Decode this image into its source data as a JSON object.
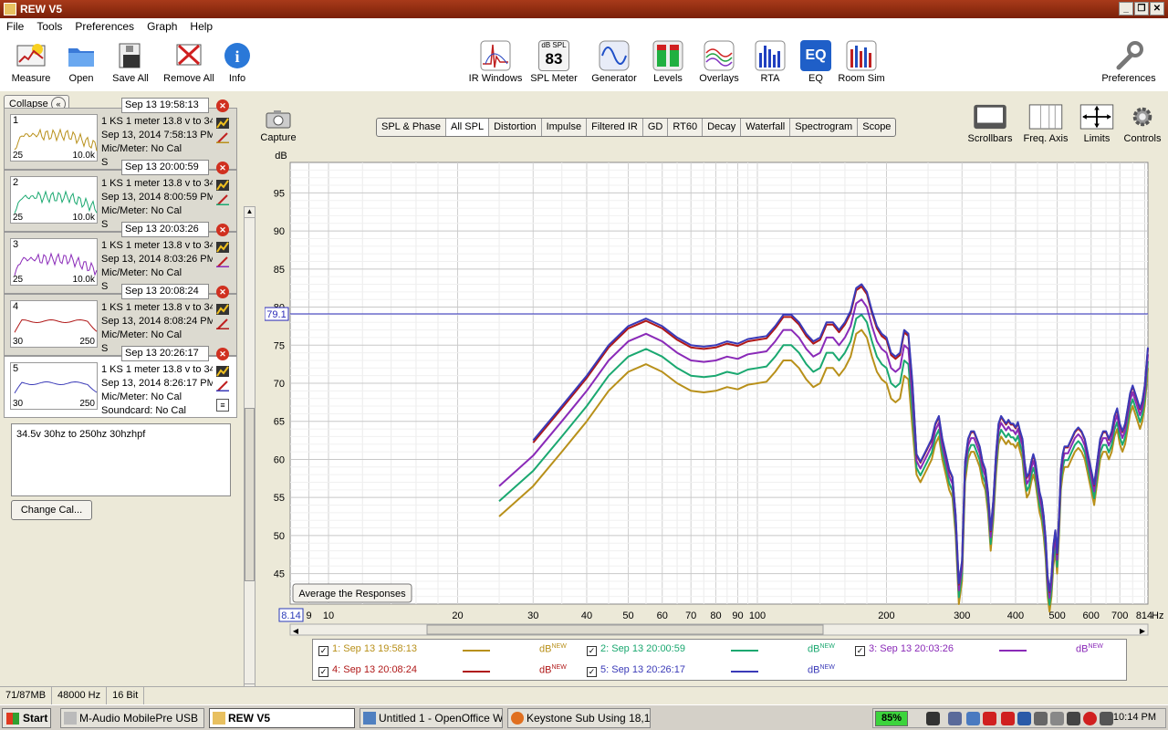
{
  "window": {
    "title": "REW V5"
  },
  "menu": [
    "File",
    "Tools",
    "Preferences",
    "Graph",
    "Help"
  ],
  "toolbar": {
    "left": [
      {
        "label": "Measure",
        "icon": "measure-icon"
      },
      {
        "label": "Open",
        "icon": "folder-icon"
      },
      {
        "label": "Save All",
        "icon": "save-icon"
      },
      {
        "label": "Remove All",
        "icon": "remove-icon"
      },
      {
        "label": "Info",
        "icon": "info-icon"
      }
    ],
    "center": [
      {
        "label": "IR Windows",
        "icon": "ir-windows-icon"
      },
      {
        "label": "SPL Meter",
        "icon": "spl-meter-icon",
        "badge_top": "dB SPL",
        "badge_value": "83"
      },
      {
        "label": "Generator",
        "icon": "generator-icon"
      },
      {
        "label": "Levels",
        "icon": "levels-icon"
      },
      {
        "label": "Overlays",
        "icon": "overlays-icon"
      },
      {
        "label": "RTA",
        "icon": "rta-icon"
      },
      {
        "label": "EQ",
        "icon": "eq-icon",
        "badge_value": "EQ"
      },
      {
        "label": "Room Sim",
        "icon": "room-sim-icon"
      }
    ],
    "right": {
      "label": "Preferences",
      "icon": "wrench-icon"
    }
  },
  "left_panel": {
    "collapse_label": "Collapse",
    "measurements": [
      {
        "num": "1",
        "date": "Sep 13 19:58:13",
        "line1": "1 KS 1 meter 13.8 v to 34",
        "line2": "Sep 13, 2014 7:58:13 PM",
        "line3": "Mic/Meter: No Cal",
        "line4": "S",
        "thumb_low": "25",
        "thumb_high": "10.0k",
        "color": "#b8901a"
      },
      {
        "num": "2",
        "date": "Sep 13 20:00:59",
        "line1": "1 KS 1 meter 13.8 v to 34",
        "line2": "Sep 13, 2014 8:00:59 PM",
        "line3": "Mic/Meter: No Cal",
        "line4": "S",
        "thumb_low": "25",
        "thumb_high": "10.0k",
        "color": "#1aa870"
      },
      {
        "num": "3",
        "date": "Sep 13 20:03:26",
        "line1": "1 KS 1 meter 13.8 v to 34",
        "line2": "Sep 13, 2014 8:03:26 PM",
        "line3": "Mic/Meter: No Cal",
        "line4": "S",
        "thumb_low": "25",
        "thumb_high": "10.0k",
        "color": "#8a2ab8"
      },
      {
        "num": "4",
        "date": "Sep 13 20:08:24",
        "line1": "1 KS 1 meter 13.8 v to 34",
        "line2": "Sep 13, 2014 8:08:24 PM",
        "line3": "Mic/Meter: No Cal",
        "line4": "S",
        "thumb_low": "30",
        "thumb_high": "250",
        "color": "#b01818"
      },
      {
        "num": "5",
        "date": "Sep 13 20:26:17",
        "line1": "1 KS 1 meter 13.8 v to 34",
        "line2": "Sep 13, 2014 8:26:17 PM",
        "line3": "Mic/Meter: No Cal",
        "line4": "Soundcard: No Cal",
        "thumb_low": "30",
        "thumb_high": "250",
        "color": "#3a3ab8"
      }
    ],
    "notes": "34.5v 30hz to 250hz 30hzhpf",
    "change_cal_label": "Change Cal..."
  },
  "capture_label": "Capture",
  "tabs": [
    "SPL & Phase",
    "All SPL",
    "Distortion",
    "Impulse",
    "Filtered IR",
    "GD",
    "RT60",
    "Decay",
    "Waterfall",
    "Spectrogram",
    "Scope"
  ],
  "active_tab": "All SPL",
  "right_tools": [
    {
      "label": "Scrollbars",
      "icon": "scrollbars-icon"
    },
    {
      "label": "Freq. Axis",
      "icon": "freq-axis-icon"
    },
    {
      "label": "Limits",
      "icon": "limits-icon"
    },
    {
      "label": "Controls",
      "icon": "gear-icon"
    }
  ],
  "average_button": "Average the Responses",
  "chart_data": {
    "type": "line",
    "ylabel": "dB",
    "xunit": "Hz",
    "xscale": "log",
    "xlim": [
      8.14,
      814
    ],
    "ylim": [
      41,
      99
    ],
    "yticks": [
      45,
      50,
      55,
      60,
      65,
      70,
      75,
      80,
      85,
      90,
      95
    ],
    "xtick_labels": [
      {
        "v": 8.14,
        "t": "8.14"
      },
      {
        "v": 9,
        "t": "9"
      },
      {
        "v": 10,
        "t": "10"
      },
      {
        "v": 20,
        "t": "20"
      },
      {
        "v": 30,
        "t": "30"
      },
      {
        "v": 40,
        "t": "40"
      },
      {
        "v": 50,
        "t": "50"
      },
      {
        "v": 60,
        "t": "60"
      },
      {
        "v": 70,
        "t": "70"
      },
      {
        "v": 80,
        "t": "80"
      },
      {
        "v": 90,
        "t": "90"
      },
      {
        "v": 100,
        "t": "100"
      },
      {
        "v": 200,
        "t": "200"
      },
      {
        "v": 300,
        "t": "300"
      },
      {
        "v": 400,
        "t": "400"
      },
      {
        "v": 500,
        "t": "500"
      },
      {
        "v": 600,
        "t": "600"
      },
      {
        "v": 700,
        "t": "700"
      },
      {
        "v": 814,
        "t": "814"
      }
    ],
    "cursor_y": 79.1,
    "cursor_label": "79.1",
    "series": [
      {
        "name": "1: Sep 13 19:58:13",
        "color": "#b8901a",
        "offset": 0,
        "start": 25
      },
      {
        "name": "2: Sep 13 20:00:59",
        "color": "#1aa870",
        "offset": 2.0,
        "start": 25
      },
      {
        "name": "3: Sep 13 20:03:26",
        "color": "#8a2ab8",
        "offset": 4.0,
        "start": 25
      },
      {
        "name": "4: Sep 13 20:08:24",
        "color": "#b01818",
        "offset": 5.7,
        "start": 30
      },
      {
        "name": "5: Sep 13 20:26:17",
        "color": "#3a3ab8",
        "offset": 6.0,
        "start": 30
      }
    ],
    "base_curve": [
      [
        25,
        52.5
      ],
      [
        30,
        56.5
      ],
      [
        35,
        61
      ],
      [
        40,
        65
      ],
      [
        45,
        69
      ],
      [
        50,
        71.5
      ],
      [
        55,
        72.5
      ],
      [
        60,
        71.5
      ],
      [
        65,
        70
      ],
      [
        70,
        69
      ],
      [
        75,
        68.8
      ],
      [
        80,
        69
      ],
      [
        85,
        69.5
      ],
      [
        90,
        69.2
      ],
      [
        95,
        69.8
      ],
      [
        100,
        70
      ],
      [
        105,
        70.2
      ],
      [
        110,
        71.5
      ],
      [
        115,
        73
      ],
      [
        120,
        73
      ],
      [
        125,
        72
      ],
      [
        130,
        70.5
      ],
      [
        135,
        69.5
      ],
      [
        140,
        70
      ],
      [
        145,
        72
      ],
      [
        150,
        72
      ],
      [
        155,
        71
      ],
      [
        160,
        72
      ],
      [
        165,
        73.5
      ],
      [
        170,
        76.5
      ],
      [
        175,
        77
      ],
      [
        180,
        76
      ],
      [
        185,
        73.5
      ],
      [
        190,
        71.5
      ],
      [
        195,
        70.5
      ],
      [
        200,
        70
      ],
      [
        205,
        68
      ],
      [
        210,
        67.5
      ],
      [
        215,
        68
      ],
      [
        220,
        71
      ],
      [
        225,
        70.5
      ],
      [
        230,
        64
      ],
      [
        235,
        58
      ],
      [
        240,
        57
      ],
      [
        245,
        58
      ],
      [
        250,
        59
      ],
      [
        255,
        60
      ],
      [
        260,
        62
      ],
      [
        265,
        63
      ],
      [
        270,
        60
      ],
      [
        275,
        58
      ],
      [
        280,
        56
      ],
      [
        285,
        55
      ],
      [
        290,
        50
      ],
      [
        295,
        41
      ],
      [
        300,
        44
      ],
      [
        305,
        57
      ],
      [
        310,
        60
      ],
      [
        315,
        61
      ],
      [
        320,
        61
      ],
      [
        325,
        60
      ],
      [
        330,
        59
      ],
      [
        335,
        57
      ],
      [
        340,
        56
      ],
      [
        345,
        53
      ],
      [
        350,
        48
      ],
      [
        355,
        52
      ],
      [
        360,
        58
      ],
      [
        365,
        62
      ],
      [
        370,
        63
      ],
      [
        375,
        62.5
      ],
      [
        380,
        62
      ],
      [
        385,
        62.5
      ],
      [
        390,
        62
      ],
      [
        395,
        62
      ],
      [
        400,
        61.5
      ],
      [
        405,
        62.2
      ],
      [
        410,
        61
      ],
      [
        415,
        60
      ],
      [
        420,
        57
      ],
      [
        425,
        55
      ],
      [
        430,
        55.5
      ],
      [
        435,
        57
      ],
      [
        440,
        58
      ],
      [
        445,
        57
      ],
      [
        450,
        55
      ],
      [
        455,
        53
      ],
      [
        460,
        52
      ],
      [
        465,
        50
      ],
      [
        470,
        47
      ],
      [
        475,
        42
      ],
      [
        480,
        40
      ],
      [
        485,
        42
      ],
      [
        490,
        46
      ],
      [
        495,
        48
      ],
      [
        500,
        45
      ],
      [
        505,
        50
      ],
      [
        510,
        56
      ],
      [
        515,
        58
      ],
      [
        520,
        59
      ],
      [
        530,
        59
      ],
      [
        540,
        60
      ],
      [
        550,
        61
      ],
      [
        560,
        61.5
      ],
      [
        570,
        61
      ],
      [
        580,
        60
      ],
      [
        590,
        58
      ],
      [
        600,
        56
      ],
      [
        610,
        54
      ],
      [
        620,
        57
      ],
      [
        630,
        60
      ],
      [
        640,
        61
      ],
      [
        650,
        61
      ],
      [
        660,
        60
      ],
      [
        670,
        61
      ],
      [
        680,
        63
      ],
      [
        690,
        64
      ],
      [
        700,
        62
      ],
      [
        710,
        61
      ],
      [
        720,
        62
      ],
      [
        730,
        64
      ],
      [
        740,
        66
      ],
      [
        750,
        67
      ],
      [
        760,
        66
      ],
      [
        770,
        65
      ],
      [
        780,
        64
      ],
      [
        790,
        65
      ],
      [
        800,
        67
      ],
      [
        814,
        72
      ]
    ],
    "units_label": "dB",
    "units_suffix": "NEW"
  },
  "statusbar": [
    "71/87MB",
    "48000 Hz",
    "16 Bit"
  ],
  "taskbar": {
    "start": "Start",
    "tasks": [
      "M-Audio MobilePre USB",
      "REW V5",
      "Untitled 1 - OpenOffice W...",
      "Keystone Sub Using 18,1..."
    ],
    "battery": "85%",
    "time": "10:14 PM"
  }
}
